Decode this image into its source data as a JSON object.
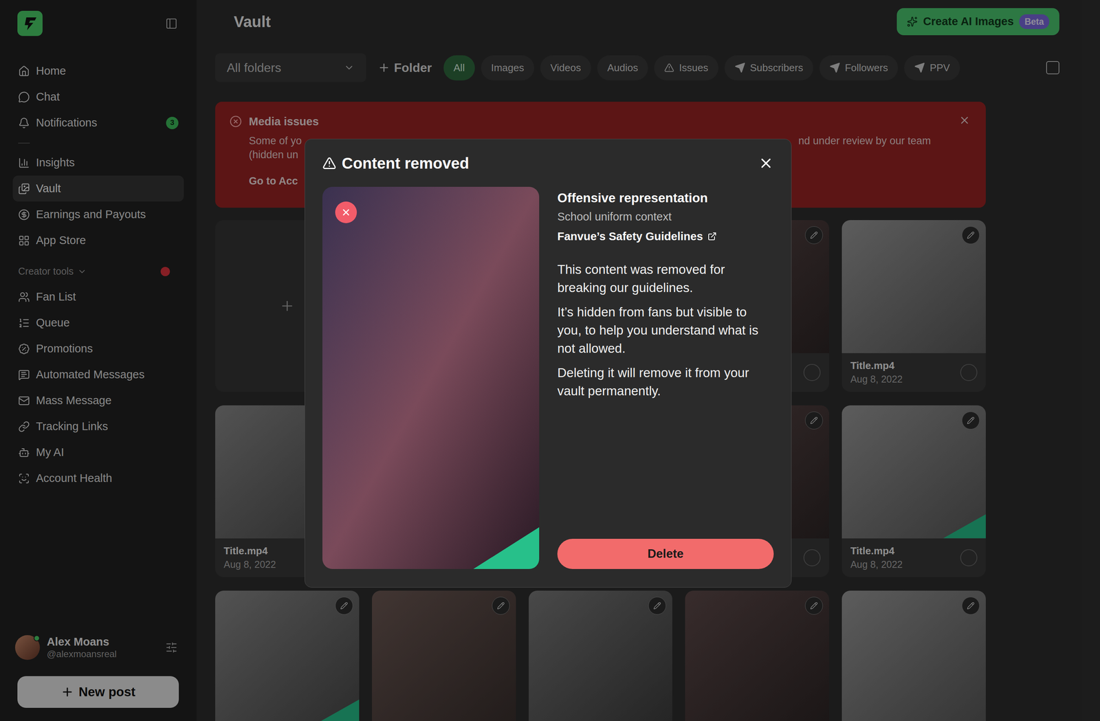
{
  "sidebar": {
    "primary": [
      {
        "label": "Home",
        "selected": false
      },
      {
        "label": "Chat",
        "selected": false
      },
      {
        "label": "Notifications",
        "selected": false,
        "badge": "3"
      }
    ],
    "main": [
      {
        "label": "Insights",
        "selected": false
      },
      {
        "label": "Vault",
        "selected": true
      },
      {
        "label": "Earnings and Payouts",
        "selected": false
      },
      {
        "label": "App Store",
        "selected": false
      }
    ],
    "creator_tools": {
      "label": "Creator tools",
      "expanded": true,
      "alert": true,
      "items": [
        {
          "label": "Fan List",
          "selected": false
        },
        {
          "label": "Queue",
          "selected": false
        },
        {
          "label": "Promotions",
          "selected": false
        },
        {
          "label": "Automated Messages",
          "selected": false
        },
        {
          "label": "Mass Message",
          "selected": false
        },
        {
          "label": "Tracking Links",
          "selected": false
        },
        {
          "label": "My AI",
          "selected": false
        },
        {
          "label": "Account Health",
          "selected": false
        }
      ]
    },
    "user": {
      "name": "Alex Moans",
      "handle": "@alexmoansreal",
      "online": true
    },
    "new_post": "New post"
  },
  "header": {
    "title": "Vault",
    "create_button": {
      "label": "Create AI Images",
      "badge": "Beta"
    }
  },
  "filters": {
    "folder_select": "All folders",
    "add_folder": "Folder",
    "pills": [
      {
        "label": "All",
        "selected": true,
        "kind": "plain"
      },
      {
        "label": "Images",
        "selected": false,
        "kind": "plain"
      },
      {
        "label": "Videos",
        "selected": false,
        "kind": "plain"
      },
      {
        "label": "Audios",
        "selected": false,
        "kind": "plain"
      },
      {
        "label": "Issues",
        "selected": false,
        "kind": "issue"
      },
      {
        "label": "Subscribers",
        "selected": false,
        "kind": "audience"
      },
      {
        "label": "Followers",
        "selected": false,
        "kind": "audience"
      },
      {
        "label": "PPV",
        "selected": false,
        "kind": "audience"
      }
    ],
    "select_all": {
      "checked": false
    }
  },
  "banner": {
    "title": "Media issues",
    "lines": [
      {
        "left": "Some of yo",
        "right": "nd under review by our team"
      },
      {
        "left": "(hidden un",
        "right": ""
      }
    ],
    "link": "Go to Acc"
  },
  "grid": {
    "cards": [
      {
        "kind": "upload"
      },
      {
        "kind": "media",
        "flagged": false,
        "selected": false
      },
      {
        "kind": "media",
        "flagged": false,
        "selected": false
      },
      {
        "kind": "media",
        "flagged": false,
        "selected": false
      },
      {
        "kind": "media",
        "title": "Title.mp4",
        "date": "Aug 8, 2022",
        "flagged": false,
        "selected": false
      },
      {
        "kind": "media",
        "title": "Title.mp4",
        "date": "Aug 8, 2022",
        "flagged": false,
        "selected": false
      },
      {
        "kind": "media",
        "flagged": false,
        "selected": false
      },
      {
        "kind": "media",
        "flagged": false,
        "selected": false
      },
      {
        "kind": "media",
        "flagged": false,
        "selected": false
      },
      {
        "kind": "media",
        "title": "Title.mp4",
        "date": "Aug 8, 2022",
        "flagged": true,
        "selected": false
      },
      {
        "kind": "media",
        "flagged": true,
        "selected": false
      },
      {
        "kind": "media",
        "flagged": false,
        "selected": false
      },
      {
        "kind": "media",
        "flagged": false,
        "selected": false
      },
      {
        "kind": "media",
        "flagged": false,
        "selected": false
      },
      {
        "kind": "media",
        "flagged": false,
        "selected": false
      }
    ]
  },
  "modal": {
    "title": "Content removed",
    "reason": "Offensive representation",
    "context": "School uniform context",
    "link": "Fanvue’s Safety Guidelines",
    "paragraphs": [
      "This content was removed for breaking our guidelines.",
      "It’s hidden from fans but visible to you, to help you understand what is not allowed.",
      "Deleting it will remove it from your vault permanently."
    ],
    "button": "Delete",
    "flagged": true,
    "removed": true
  }
}
